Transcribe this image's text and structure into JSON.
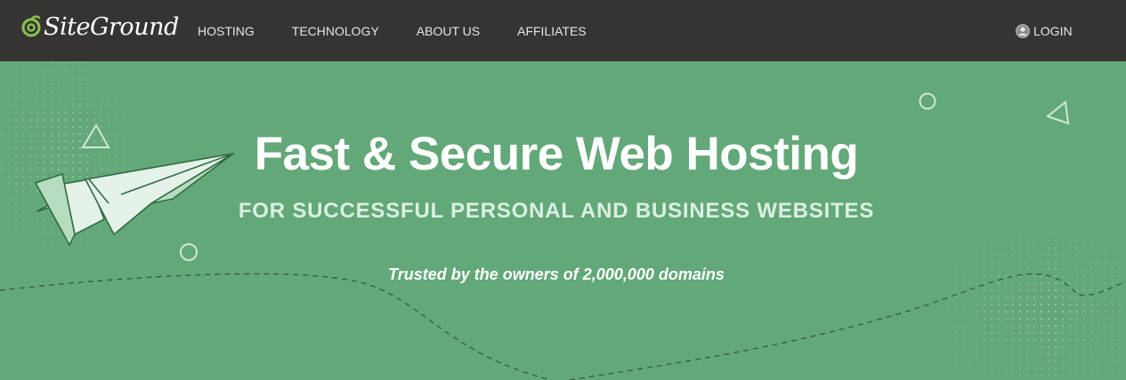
{
  "brand": {
    "name": "SiteGround"
  },
  "nav": {
    "items": [
      {
        "label": "HOSTING"
      },
      {
        "label": "TECHNOLOGY"
      },
      {
        "label": "ABOUT US"
      },
      {
        "label": "AFFILIATES"
      }
    ],
    "login_label": "LOGIN"
  },
  "hero": {
    "title": "Fast & Secure Web Hosting",
    "subtitle": "FOR SUCCESSFUL PERSONAL AND BUSINESS WEBSITES",
    "trust_line": "Trusted by the owners of 2,000,000 domains"
  },
  "colors": {
    "topbar_bg": "#363433",
    "hero_bg": "#63a878",
    "logo_accent": "#8bc34a",
    "plane_light": "#e4f2e8",
    "plane_mid": "#b6dcc0",
    "plane_outline": "#2f6b43"
  },
  "icons": {
    "logo": "siteground-swirl-icon",
    "login": "user-circle-icon",
    "plane": "paper-plane-illustration"
  }
}
